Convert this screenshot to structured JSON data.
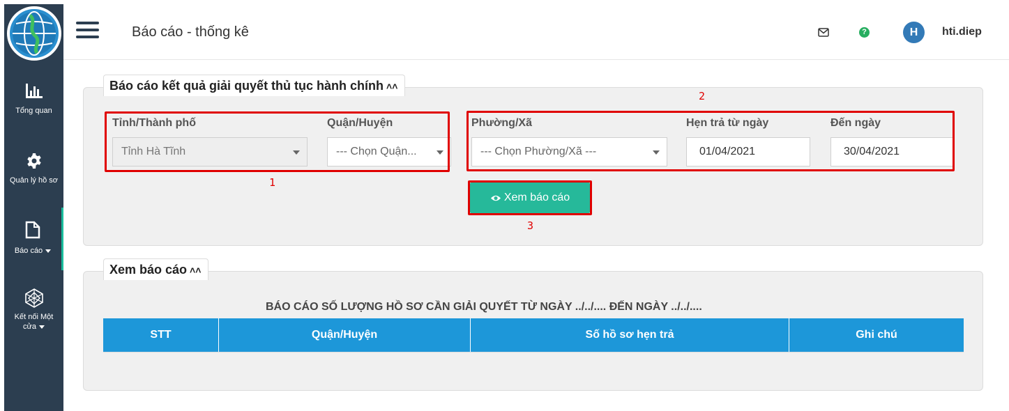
{
  "sidebar": {
    "items": [
      {
        "label": "Tổng quan",
        "icon": "bar-chart-icon"
      },
      {
        "label": "Quản lý hồ sơ",
        "icon": "gear-icon"
      },
      {
        "label": "Báo cáo",
        "icon": "file-icon"
      },
      {
        "label_line1": "Kết nối Một",
        "label_line2": "cửa",
        "icon": "network-icon"
      }
    ]
  },
  "header": {
    "title": "Báo cáo - thống kê",
    "avatar_letter": "H",
    "username": "hti.diep"
  },
  "filter_panel": {
    "title": "Báo cáo kết quả giải quyết thủ tục hành chính",
    "chevron": "«",
    "province_label": "Tỉnh/Thành phố",
    "province_value": "Tỉnh Hà Tĩnh",
    "district_label": "Quận/Huyện",
    "district_value": "--- Chọn Quận...",
    "ward_label": "Phường/Xã",
    "ward_value": "--- Chọn Phường/Xã ---",
    "from_label": "Hẹn trả từ ngày",
    "from_value": "01/04/2021",
    "to_label": "Đến ngày",
    "to_value": "30/04/2021",
    "view_button": "Xem báo cáo",
    "annotations": [
      "1",
      "2",
      "3"
    ]
  },
  "report_panel": {
    "title": "Xem báo cáo",
    "chevron": "«",
    "report_title": "BÁO CÁO SỐ LƯỢNG HỒ SƠ CẦN GIẢI QUYẾT TỪ NGÀY ../../.... ĐẾN NGÀY ../../....",
    "columns": [
      "STT",
      "Quận/Huyện",
      "Số hồ sơ hẹn trả",
      "Ghi chú"
    ]
  },
  "colors": {
    "sidebar_bg": "#2c3e50",
    "accent_green": "#26b99a",
    "table_header": "#1d97d9",
    "annotation_red": "#e00000"
  }
}
